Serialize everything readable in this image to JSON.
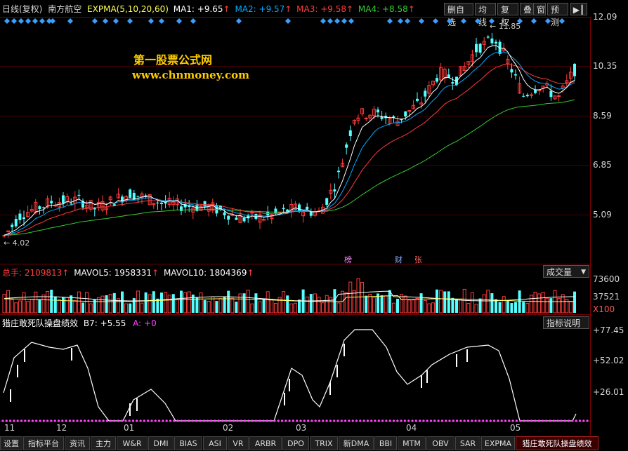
{
  "header": {
    "period": "日线(复权)",
    "stock_name": "南方航空",
    "indicator": "EXPMA(5,10,20,60)",
    "ma1": "MA1: +9.65",
    "ma2": "MA2: +9.57",
    "ma3": "MA3: +9.58",
    "ma4": "MA4: +8.58"
  },
  "toolbar": {
    "delete_self_select": "删自选",
    "ma_line": "均线",
    "fuquan": "复权",
    "overlay": "叠",
    "window": "窗",
    "forecast": "预测"
  },
  "watermark": {
    "line1": "第一股票公式网",
    "line2": "www.chnmoney.com"
  },
  "price_axis": [
    "12.09",
    "10.35",
    "8.59",
    "6.85",
    "5.09"
  ],
  "price_annotations": {
    "high": "11.85",
    "low": "4.02"
  },
  "event_marks": [
    "榜",
    "财",
    "张"
  ],
  "volume": {
    "label": "总手: 2109813",
    "mavol5": "MAVOL5: 1958331",
    "mavol10": "MAVOL10: 1804369",
    "dropdown": "成交量",
    "axis": [
      "73600",
      "37521",
      "X100"
    ]
  },
  "indicator_panel": {
    "name": "猎庄敢死队操盘绩效",
    "b7": "B7: +5.55",
    "a": "A: +0",
    "help_button": "指标说明",
    "axis": [
      "+77.45",
      "+52.02",
      "+26.01"
    ]
  },
  "x_axis": [
    "11",
    "12",
    "01",
    "02",
    "03",
    "04",
    "05"
  ],
  "tabs": [
    "设置",
    "指标平台",
    "资讯",
    "主力",
    "W&R",
    "DMI",
    "BIAS",
    "ASI",
    "VR",
    "ARBR",
    "DPO",
    "TRIX",
    "新DMA",
    "BBI",
    "MTM",
    "OBV",
    "SAR",
    "EXPMA",
    "猎庄敢死队操盘绩效"
  ],
  "colors": {
    "up": "#ff3c3c",
    "down": "#54ffff",
    "ma1": "#ffffff",
    "ma2": "#00aaff",
    "ma3": "#ff3c3c",
    "ma4": "#33cc33",
    "watermark": "#ffcc00",
    "grid": "#7a0000"
  }
}
